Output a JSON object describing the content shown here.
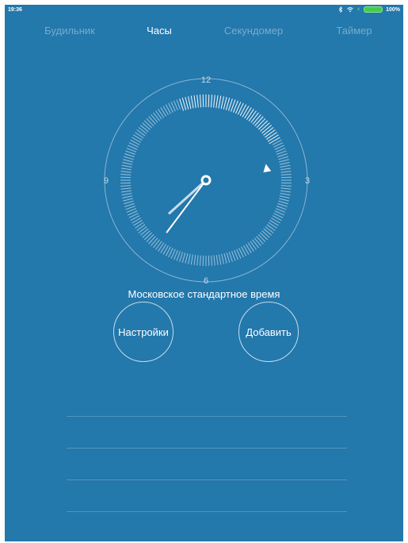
{
  "status_bar": {
    "time": "19:36",
    "battery_percent": "100%",
    "icons": [
      "bluetooth-icon",
      "wifi-icon",
      "charging-icon",
      "battery-icon"
    ]
  },
  "tabs": [
    {
      "label": "Будильник",
      "active": false
    },
    {
      "label": "Часы",
      "active": true
    },
    {
      "label": "Секундомер",
      "active": false
    },
    {
      "label": "Таймер",
      "active": false
    }
  ],
  "clock": {
    "dial_numbers": {
      "n12": "12",
      "n3": "3",
      "n6": "6",
      "n9": "9"
    },
    "time_shown": {
      "hours": 7,
      "minutes": 36,
      "seconds": 10
    }
  },
  "zone_label": "Московское стандартное время",
  "buttons": {
    "settings": "Настройки",
    "add": "Добавить"
  },
  "colors": {
    "background": "#2378ac",
    "foreground": "#ffffff"
  }
}
